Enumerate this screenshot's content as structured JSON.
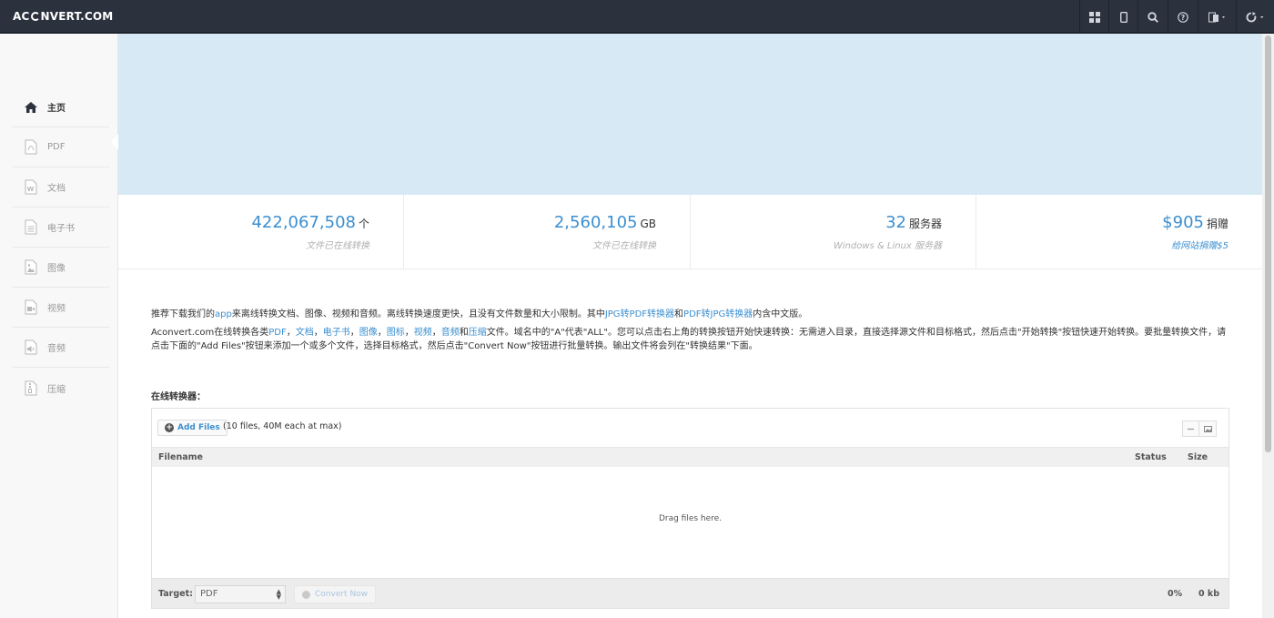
{
  "header": {
    "logo_left": "AC",
    "logo_right": "NVERT.COM",
    "buttons": [
      {
        "icon": "grid-icon"
      },
      {
        "icon": "mobile-icon"
      },
      {
        "icon": "search-icon"
      },
      {
        "icon": "help-icon"
      },
      {
        "icon": "language-icon"
      },
      {
        "icon": "refresh-icon"
      }
    ]
  },
  "sidebar": {
    "items": [
      {
        "label": "主页",
        "icon": "home-icon",
        "active": true
      },
      {
        "label": "PDF",
        "icon": "pdf-icon"
      },
      {
        "label": "文档",
        "icon": "document-icon"
      },
      {
        "label": "电子书",
        "icon": "ebook-icon"
      },
      {
        "label": "图像",
        "icon": "image-icon"
      },
      {
        "label": "视频",
        "icon": "video-icon"
      },
      {
        "label": "音频",
        "icon": "audio-icon"
      },
      {
        "label": "压缩",
        "icon": "archive-icon"
      }
    ]
  },
  "stats": [
    {
      "value": "422,067,508",
      "unit": "个",
      "sub": "文件已在线转换"
    },
    {
      "value": "2,560,105",
      "unit": "GB",
      "sub": "文件已在线转换"
    },
    {
      "value": "32",
      "unit": "服务器",
      "sub": "Windows & Linux 服务器"
    },
    {
      "value": "$905",
      "unit": "捐赠",
      "sub": "给网站捐赠$5"
    }
  ],
  "intro": {
    "p1_a": "推荐下载我们的",
    "p1_app": "app",
    "p1_b": "来离线转换文档、图像、视频和音频。离线转换速度更快，且没有文件数量和大小限制。其中",
    "p1_jpg2pdf": "JPG转PDF转换器",
    "p1_and": "和",
    "p1_pdf2jpg": "PDF转JPG转换器",
    "p1_c": "内含中文版。",
    "p2_a": "Aconvert.com在线转换各类",
    "p2_pdf": "PDF",
    "p2_doc": "文档",
    "p2_ebook": "电子书",
    "p2_image": "图像",
    "p2_icon": "图标",
    "p2_video": "视频",
    "p2_audio": "音频",
    "p2_and": "和",
    "p2_archive": "压缩",
    "p2_b": "文件。域名中的\"A\"代表\"ALL\"。您可以点击右上角的转换按钮开始快速转换：无需进入目录，直接选择源文件和目标格式，然后点击\"开始转换\"按钮快速开始转换。要批量转换文件，请点击下面的\"Add Files\"按钮来添加一个或多个文件，选择目标格式，然后点击\"Convert Now\"按钮进行批量转换。输出文件将会列在\"转换结果\"下面。",
    "sep": "，"
  },
  "converter": {
    "title": "在线转换器：",
    "add_files": "Add Files",
    "limit_note": "(10 files, 40M each at max)",
    "col_filename": "Filename",
    "col_status": "Status",
    "col_size": "Size",
    "drop_message": "Drag files here.",
    "target_label": "Target:",
    "target_value": "PDF",
    "convert_button": "Convert Now",
    "progress": "0%",
    "total_size": "0 kb"
  }
}
